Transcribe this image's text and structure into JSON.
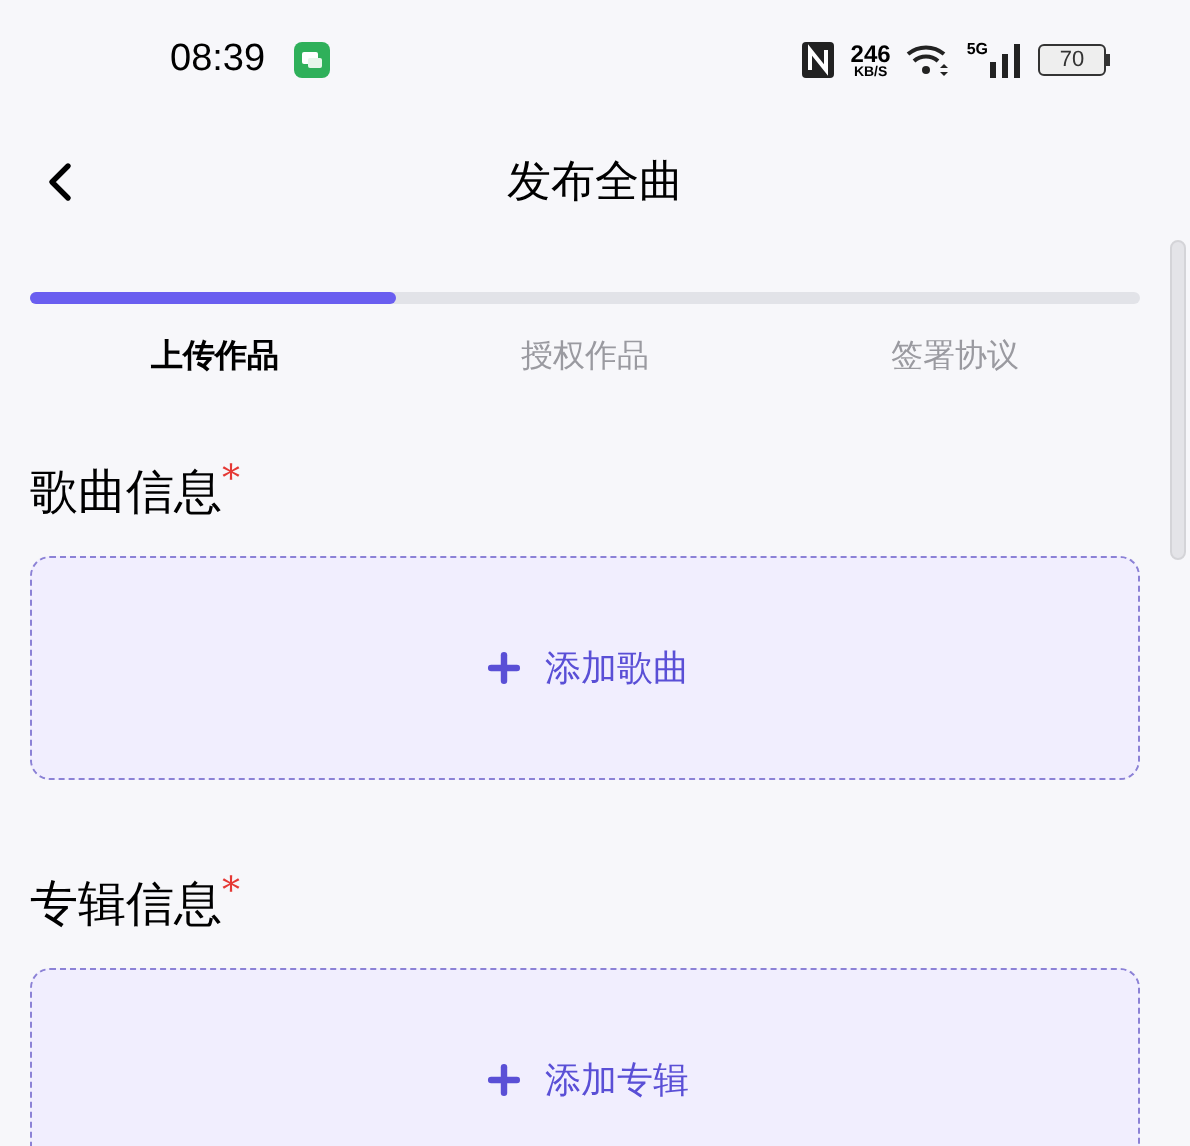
{
  "status_bar": {
    "time": "08:39",
    "network_speed": "246",
    "network_speed_unit": "KB/S",
    "signal_type": "5G",
    "battery": "70"
  },
  "header": {
    "title": "发布全曲"
  },
  "progress": {
    "level": 0.33
  },
  "steps": [
    {
      "label": "上传作品",
      "selected": true
    },
    {
      "label": "授权作品",
      "selected": false
    },
    {
      "label": "签署协议",
      "selected": false
    }
  ],
  "sections": [
    {
      "title": "歌曲信息",
      "required_mark": "*",
      "add_label": "添加歌曲"
    },
    {
      "title": "专辑信息",
      "required_mark": "*",
      "add_label": "添加专辑"
    }
  ]
}
